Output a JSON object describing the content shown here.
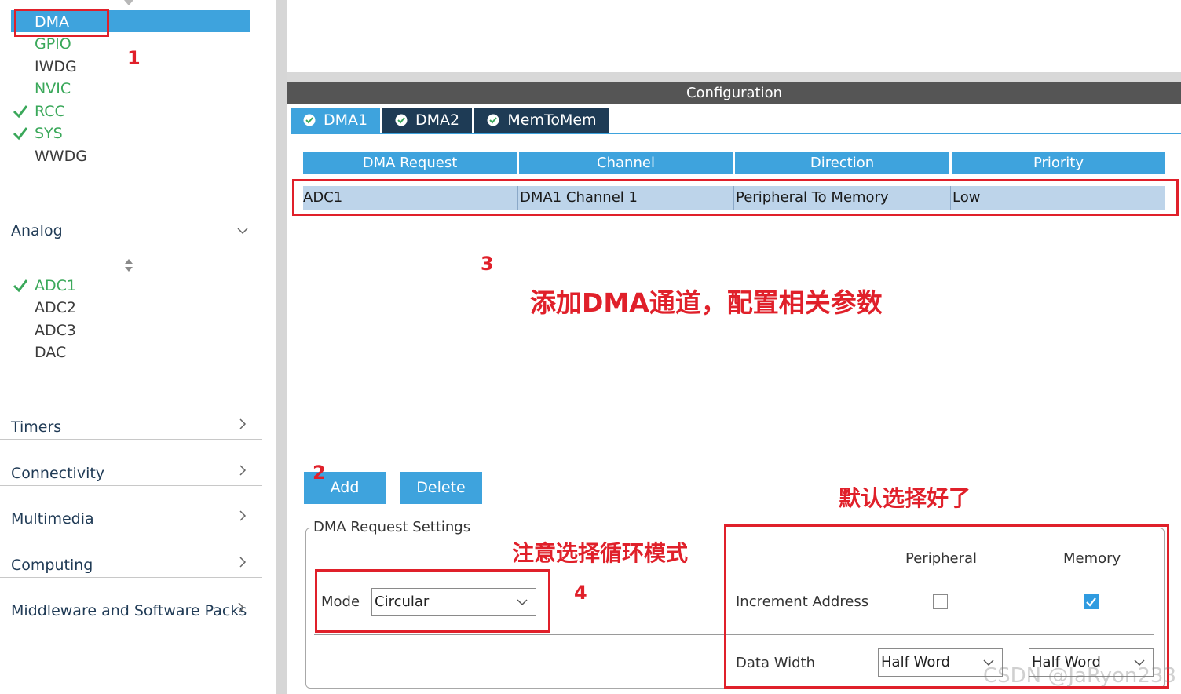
{
  "sidebar": {
    "system_items": [
      {
        "label": "DMA",
        "state": "selected",
        "checked": false
      },
      {
        "label": "GPIO",
        "state": "configured",
        "checked": false
      },
      {
        "label": "IWDG",
        "state": "normal",
        "checked": false
      },
      {
        "label": "NVIC",
        "state": "configured",
        "checked": false
      },
      {
        "label": "RCC",
        "state": "configured",
        "checked": true
      },
      {
        "label": "SYS",
        "state": "configured",
        "checked": true
      },
      {
        "label": "WWDG",
        "state": "normal",
        "checked": false
      }
    ],
    "analog": {
      "label": "Analog",
      "items": [
        {
          "label": "ADC1",
          "checked": true
        },
        {
          "label": "ADC2",
          "checked": false
        },
        {
          "label": "ADC3",
          "checked": false
        },
        {
          "label": "DAC",
          "checked": false
        }
      ]
    },
    "categories": [
      "Timers",
      "Connectivity",
      "Multimedia",
      "Computing",
      "Middleware and Software Packs"
    ]
  },
  "config": {
    "header": "Configuration",
    "tabs": [
      {
        "label": "DMA1",
        "active": true
      },
      {
        "label": "DMA2",
        "active": false
      },
      {
        "label": "MemToMem",
        "active": false
      }
    ],
    "table": {
      "headers": [
        "DMA Request",
        "Channel",
        "Direction",
        "Priority"
      ],
      "rows": [
        [
          "ADC1",
          "DMA1 Channel 1",
          "Peripheral To Memory",
          "Low"
        ]
      ]
    },
    "buttons": {
      "add": "Add",
      "delete": "Delete"
    },
    "settings": {
      "legend": "DMA Request Settings",
      "mode_label": "Mode",
      "mode_value": "Circular",
      "peripheral_header": "Peripheral",
      "memory_header": "Memory",
      "increment_label": "Increment Address",
      "increment_peripheral": false,
      "increment_memory": true,
      "data_width_label": "Data Width",
      "data_width_peripheral": "Half Word",
      "data_width_memory": "Half Word"
    }
  },
  "annotations": {
    "n1": "1",
    "n2": "2",
    "n3": "3",
    "n4": "4",
    "text3": "添加DMA通道，配置相关参数",
    "text4": "注意选择循环模式",
    "text_default": "默认选择好了"
  },
  "watermark": "CSDN @JaRyon233",
  "colors": {
    "accent": "#3ea3dd",
    "green": "#3aa85a",
    "tab_dark": "#1e3b55",
    "row_selected": "#bdd4ea",
    "annotation_red": "#e0202a"
  }
}
